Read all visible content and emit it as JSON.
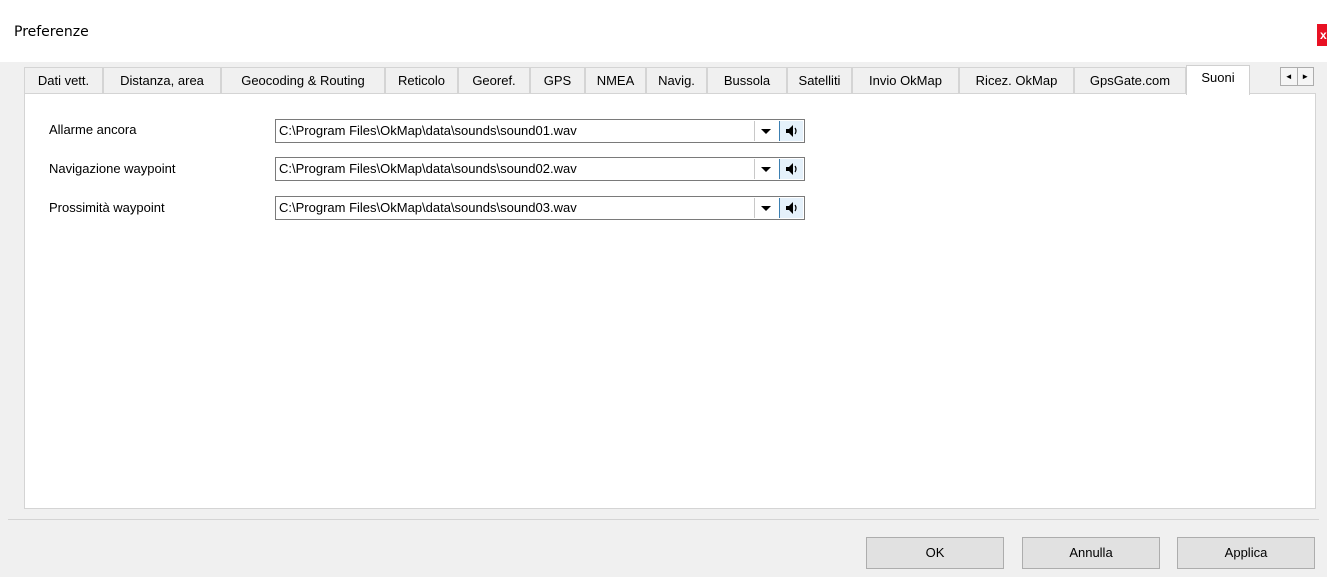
{
  "window": {
    "title": "Preferenze",
    "close": "x"
  },
  "tabs": [
    {
      "label": "Dati vett."
    },
    {
      "label": "Distanza, area"
    },
    {
      "label": "Geocoding & Routing"
    },
    {
      "label": "Reticolo"
    },
    {
      "label": "Georef."
    },
    {
      "label": "GPS"
    },
    {
      "label": "NMEA"
    },
    {
      "label": "Navig."
    },
    {
      "label": "Bussola"
    },
    {
      "label": "Satelliti"
    },
    {
      "label": "Invio OkMap"
    },
    {
      "label": "Ricez. OkMap"
    },
    {
      "label": "GpsGate.com"
    },
    {
      "label": "Suoni",
      "active": true
    }
  ],
  "tab_scroll": {
    "left": "◄",
    "right": "►"
  },
  "sounds": [
    {
      "label": "Allarme ancora",
      "value": "C:\\Program Files\\OkMap\\data\\sounds\\sound01.wav"
    },
    {
      "label": "Navigazione waypoint",
      "value": "C:\\Program Files\\OkMap\\data\\sounds\\sound02.wav"
    },
    {
      "label": "Prossimità waypoint",
      "value": "C:\\Program Files\\OkMap\\data\\sounds\\sound03.wav"
    }
  ],
  "buttons": {
    "ok": "OK",
    "cancel": "Annulla",
    "apply": "Applica"
  },
  "colors": {
    "close_bg": "#e81123",
    "speaker_bg": "#e5f1fb",
    "speaker_border": "#3c7fb1"
  }
}
